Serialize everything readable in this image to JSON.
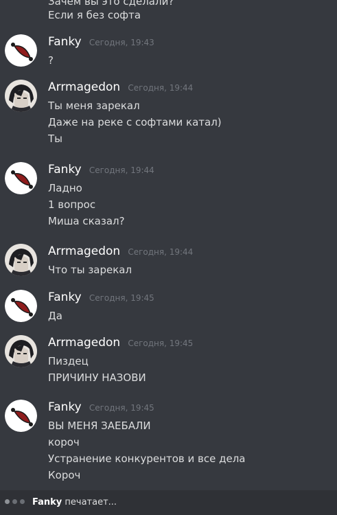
{
  "chat": {
    "cut_lines": [
      "Зачем вы это сделали?",
      "Если я без софта"
    ],
    "groups": [
      {
        "author": "Fanky",
        "avatar": "fanky-avatar",
        "time": "Сегодня, 19:43",
        "lines": [
          "?"
        ]
      },
      {
        "author": "Arrmagedon",
        "avatar": "arrmagedon-avatar",
        "time": "Сегодня, 19:44",
        "lines": [
          "Ты меня зарекал",
          "Даже на реке с софтами катал)",
          "Ты"
        ]
      },
      {
        "author": "Fanky",
        "avatar": "fanky-avatar",
        "time": "Сегодня, 19:44",
        "lines": [
          "Ладно",
          "1 вопрос",
          "Миша сказал?"
        ]
      },
      {
        "author": "Arrmagedon",
        "avatar": "arrmagedon-avatar",
        "time": "Сегодня, 19:44",
        "lines": [
          "Что ты зарекал"
        ]
      },
      {
        "author": "Fanky",
        "avatar": "fanky-avatar",
        "time": "Сегодня, 19:45",
        "lines": [
          "Да"
        ]
      },
      {
        "author": "Arrmagedon",
        "avatar": "arrmagedon-avatar",
        "time": "Сегодня, 19:45",
        "lines": [
          "Пиздец",
          "ПРИЧИНУ НАЗОВИ"
        ]
      },
      {
        "author": "Fanky",
        "avatar": "fanky-avatar",
        "time": "Сегодня, 19:45",
        "lines": [
          "ВЫ МЕНЯ ЗАЕБАЛИ",
          "короч",
          "Устранение конкурентов и все дела",
          "Короч"
        ]
      }
    ]
  },
  "typing": {
    "user": "Fanky",
    "text": "печатает..."
  },
  "colors": {
    "background": "#36393f",
    "typing_bar": "#2f3136",
    "username": "#ffffff",
    "timestamp": "#72767d",
    "message_text": "#dcddde"
  }
}
